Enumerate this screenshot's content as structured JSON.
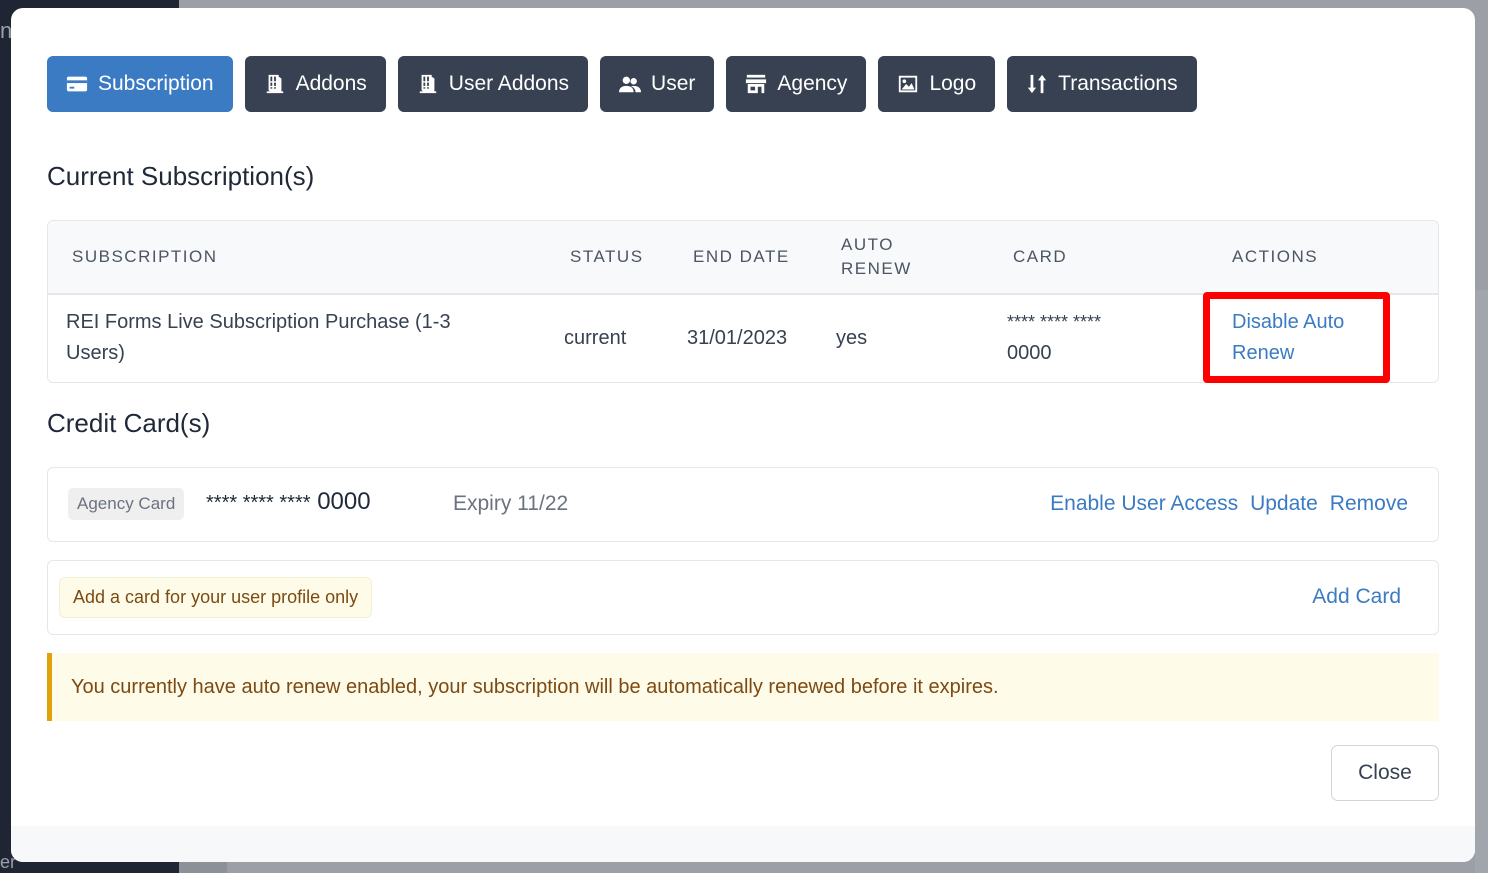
{
  "background": {
    "peek_top": "n",
    "peek_bottom": "er"
  },
  "tabs": [
    {
      "label": "Subscription",
      "icon": "credit-card-icon",
      "active": true
    },
    {
      "label": "Addons",
      "icon": "pallet-boxes-icon",
      "active": false
    },
    {
      "label": "User Addons",
      "icon": "pallet-boxes-icon",
      "active": false
    },
    {
      "label": "User",
      "icon": "users-icon",
      "active": false
    },
    {
      "label": "Agency",
      "icon": "store-icon",
      "active": false
    },
    {
      "label": "Logo",
      "icon": "image-icon",
      "active": false
    },
    {
      "label": "Transactions",
      "icon": "sort-arrows-icon",
      "active": false
    }
  ],
  "subscriptions": {
    "title": "Current Subscription(s)",
    "columns": [
      "SUBSCRIPTION",
      "STATUS",
      "END DATE",
      "AUTO",
      "RENEW",
      "CARD",
      "ACTIONS"
    ],
    "rows": [
      {
        "subscription_line1": "REI Forms Live Subscription Purchase (1-3",
        "subscription_line2": "Users)",
        "status": "current",
        "end_date": "31/01/2023",
        "auto_renew": "yes",
        "card_line1": "**** **** ****",
        "card_line2": "0000",
        "action_line1": "Disable Auto",
        "action_line2": "Renew"
      }
    ]
  },
  "credit_cards": {
    "title": "Credit Card(s)",
    "cards": [
      {
        "badge": "Agency Card",
        "mask": "**** **** ****",
        "last4": "0000",
        "expiry": "Expiry 11/22",
        "actions": [
          "Enable User Access",
          "Update",
          "Remove"
        ]
      }
    ],
    "add_card_note": "Add a card for your user profile only",
    "add_card_label": "Add Card"
  },
  "alert": {
    "message": "You currently have auto renew enabled, your subscription will be automatically renewed before it expires."
  },
  "footer": {
    "close_label": "Close"
  },
  "colors": {
    "primary": "#3a7bc4",
    "tab_dark": "#374151",
    "highlight": "#ff0000",
    "alert_border": "#e0a10b"
  }
}
